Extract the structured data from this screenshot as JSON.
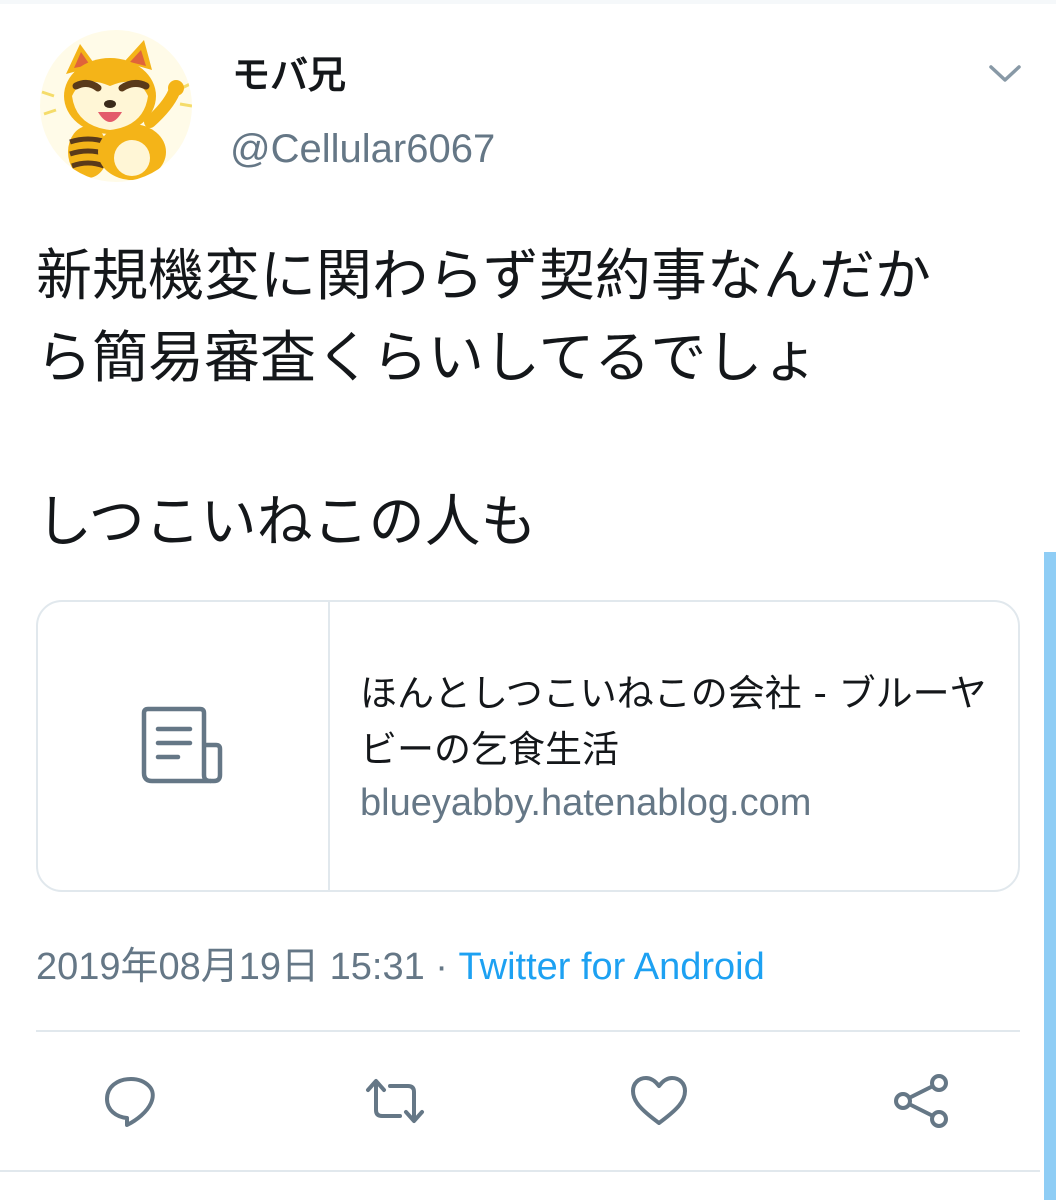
{
  "tweet": {
    "author": {
      "display_name": "モバ兄",
      "handle": "@Cellular6067"
    },
    "text_lines": [
      "新規機変に関わらず契約事なんだか",
      "ら簡易審査くらいしてるでしょ",
      "しつこいねこの人も"
    ],
    "link_card": {
      "title": "ほんとしつこいねこの会社 - ブルーヤビーの乞食生活",
      "domain": "blueyabby.hatenablog.com"
    },
    "timestamp": "2019年08月19日 15:31",
    "separator": "·",
    "source": "Twitter for Android"
  },
  "actions": [
    {
      "name": "reply",
      "icon": "reply-icon"
    },
    {
      "name": "retweet",
      "icon": "retweet-icon"
    },
    {
      "name": "like",
      "icon": "heart-icon"
    },
    {
      "name": "share",
      "icon": "share-icon"
    }
  ],
  "colors": {
    "text": "#14171a",
    "secondary": "#657786",
    "accent": "#1da1f2",
    "border": "#e1e8ed",
    "scrollbar": "#8fcdf5"
  }
}
